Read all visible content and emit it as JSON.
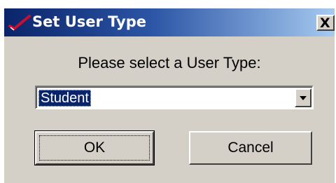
{
  "dialog": {
    "title": "Set User Type",
    "title_icon": "check-mark-icon",
    "close_glyph": "X",
    "prompt": "Please select a User Type:",
    "user_type_select": {
      "selected_value": "Student"
    },
    "buttons": {
      "ok_label": "OK",
      "cancel_label": "Cancel"
    }
  },
  "colors": {
    "titlebar_start": "#0a246a",
    "titlebar_end": "#a6caf0",
    "dialog_face": "#d4d0c8",
    "selection": "#0a246a",
    "icon_mark": "#c8102e"
  }
}
